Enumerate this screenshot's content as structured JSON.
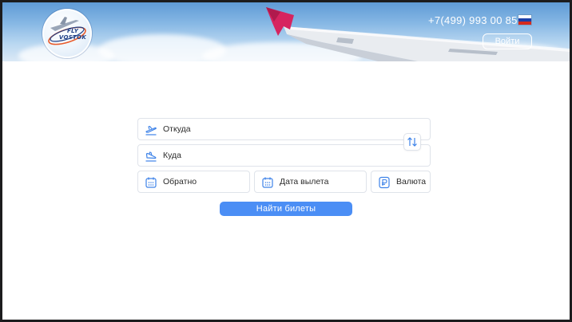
{
  "header": {
    "logo": {
      "line1": "FLY",
      "line2": "VOSTOK"
    },
    "phone": "+7(499) 993 00 85",
    "language_flag": "russia-flag",
    "login_label": "Войти"
  },
  "search_form": {
    "from": {
      "label": "Откуда",
      "icon": "takeoff-icon"
    },
    "to": {
      "label": "Куда",
      "icon": "landing-icon"
    },
    "swap_icon": "swap-arrows-icon",
    "return": {
      "label": "Обратно",
      "icon": "calendar-icon"
    },
    "departure_date": {
      "label": "Дата вылета",
      "icon": "calendar-icon"
    },
    "currency": {
      "label": "Валюта",
      "icon": "currency-icon"
    },
    "submit_label": "Найти билеты"
  },
  "colors": {
    "accent": "#4b8ef5",
    "icon": "#3d82e8",
    "wing_tip": "#d6245f"
  }
}
